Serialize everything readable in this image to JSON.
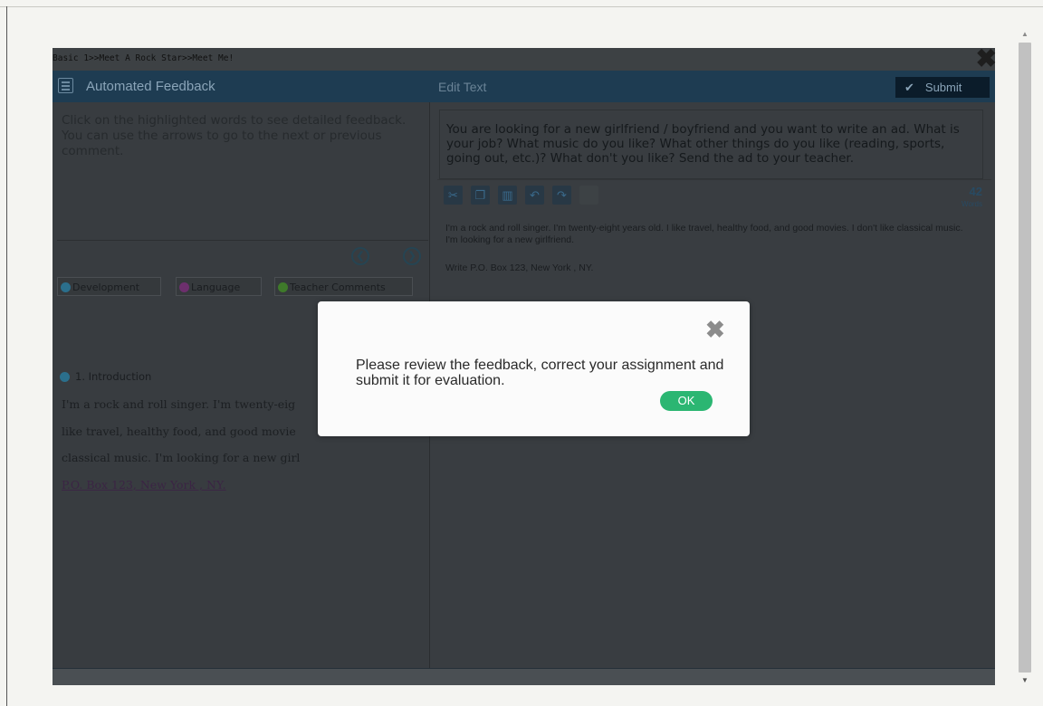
{
  "breadcrumb": "Basic 1>>Meet A Rock Star>>Meet Me!",
  "feedback_panel": {
    "title": "Automated Feedback",
    "instructions": "Click on the highlighted words to see detailed feedback. You can use the arrows to go to the next or previous comment.",
    "tabs": [
      "Development",
      "Language",
      "Teacher Comments"
    ],
    "section_heading": "1. Introduction",
    "essay_lines": [
      "I'm a rock and roll singer. I'm twenty-eig",
      "like travel, healthy food, and good movie",
      "classical music. I'm looking for a new girl"
    ],
    "address_link": "P.O. Box 123, New York , NY."
  },
  "edit_panel": {
    "title": "Edit Text",
    "submit_label": "Submit",
    "prompt": "You are looking for a new girlfriend / boyfriend and you want to write an ad. What is your job? What music do you like? What other things do you like (reading, sports, going out, etc.)? What don't you like? Send the ad to your teacher.",
    "word_count": "42",
    "word_count_label": "Words",
    "essay_text": "I'm a rock and roll singer. I'm twenty-eight years old. I like travel, healthy food, and good movies. I don't like classical music. I'm looking for a new girlfriend.",
    "essay_address": "Write P.O. Box 123, New York , NY."
  },
  "modal": {
    "message": "Please review the feedback, correct your assignment and submit it for evaluation.",
    "ok_label": "OK"
  },
  "colors": {
    "accent": "#2bb672",
    "header": "#1e3c52",
    "development_dot": "#2b6f8c",
    "language_dot": "#6d2f6d",
    "teacher_dot": "#3f7a2a"
  }
}
